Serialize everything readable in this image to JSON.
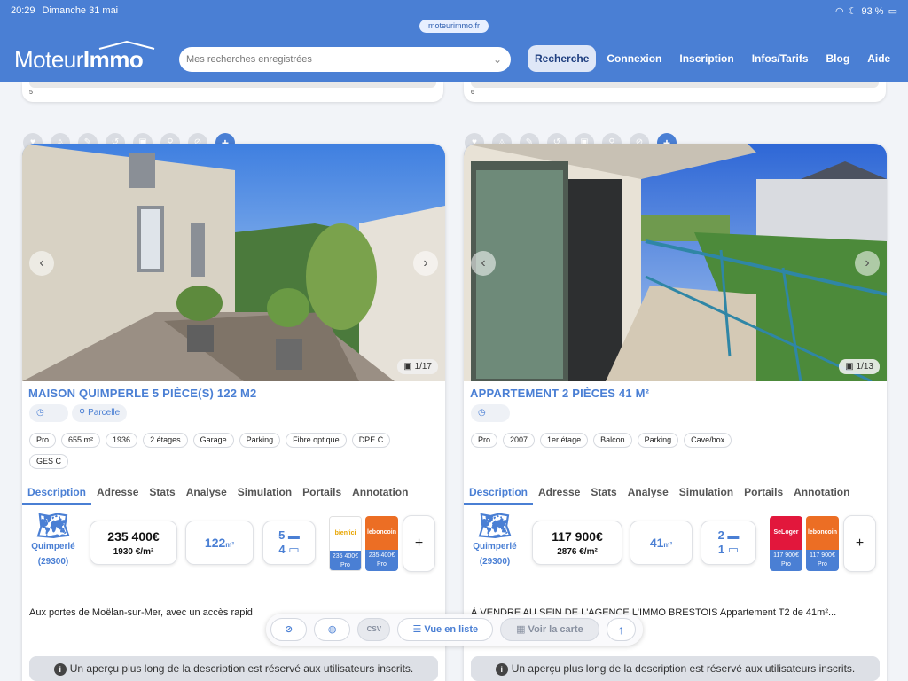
{
  "status": {
    "time": "20:29",
    "date": "Dimanche 31 mai",
    "battery": "93 %"
  },
  "browser": {
    "url": "moteurimmo.fr"
  },
  "header": {
    "logo_a": "Moteur",
    "logo_b": "Immo",
    "search_placeholder": "Mes recherches enregistrées",
    "nav": [
      "Recherche",
      "Connexion",
      "Inscription",
      "Infos/Tarifs",
      "Blog",
      "Aide"
    ]
  },
  "prev": {
    "left_num": "5",
    "right_num": "6"
  },
  "icons": {
    "tools": [
      "heart-icon",
      "bell-icon",
      "pencil-icon",
      "history-icon",
      "camera-icon",
      "pin-icon",
      "hide-icon",
      "plus-icon"
    ]
  },
  "cards": [
    {
      "title": "MAISON QUIMPERLE 5 PIÈCE(S) 122 M2",
      "photo_counter": "1/17",
      "location_chip": "Parcelle",
      "tags": [
        "Pro",
        "655 m²",
        "1936",
        "2 étages",
        "Garage",
        "Parking",
        "Fibre optique",
        "DPE C",
        "GES C"
      ],
      "tabs": [
        "Description",
        "Adresse",
        "Stats",
        "Analyse",
        "Simulation",
        "Portails",
        "Annotation"
      ],
      "city": "Quimperlé",
      "zip": "(29300)",
      "price": "235 400€",
      "price_m2": "1930 €/m²",
      "surface": "122",
      "surface_unit": "m²",
      "rooms": "5",
      "bedrooms": "4",
      "portals": [
        {
          "name": "bien'ici",
          "price": "235 400€",
          "kind": "Pro",
          "color": "#ffffff"
        },
        {
          "name": "leboncoin",
          "price": "235 400€",
          "kind": "Pro",
          "color": "#ec6e24"
        }
      ],
      "description": "Aux portes de Moëlan-sur-Mer, avec un accès rapid",
      "note": "Un aperçu plus long de la description est réservé aux utilisateurs inscrits."
    },
    {
      "title": "APPARTEMENT 2 PIÈCES 41 M²",
      "photo_counter": "1/13",
      "tags": [
        "Pro",
        "2007",
        "1er étage",
        "Balcon",
        "Parking",
        "Cave/box"
      ],
      "tabs": [
        "Description",
        "Adresse",
        "Stats",
        "Analyse",
        "Simulation",
        "Portails",
        "Annotation"
      ],
      "city": "Quimperlé",
      "zip": "(29300)",
      "price": "117 900€",
      "price_m2": "2876 €/m²",
      "surface": "41",
      "surface_unit": "m²",
      "rooms": "2",
      "bedrooms": "1",
      "portals": [
        {
          "name": "SeLoger",
          "price": "117 900€",
          "kind": "Pro",
          "color": "#e2173c"
        },
        {
          "name": "leboncoin",
          "price": "117 900€",
          "kind": "Pro",
          "color": "#ec6e24"
        }
      ],
      "description": "À VENDRE AU SEIN DE L'AGENCE L'IMMO BRESTOIS Appartement T2 de 41m²...",
      "note": "Un aperçu plus long de la description est réservé aux utilisateurs inscrits."
    }
  ],
  "floatbar": {
    "list_view": "Vue en liste",
    "map_view": "Voir la carte",
    "csv": "CSV"
  }
}
